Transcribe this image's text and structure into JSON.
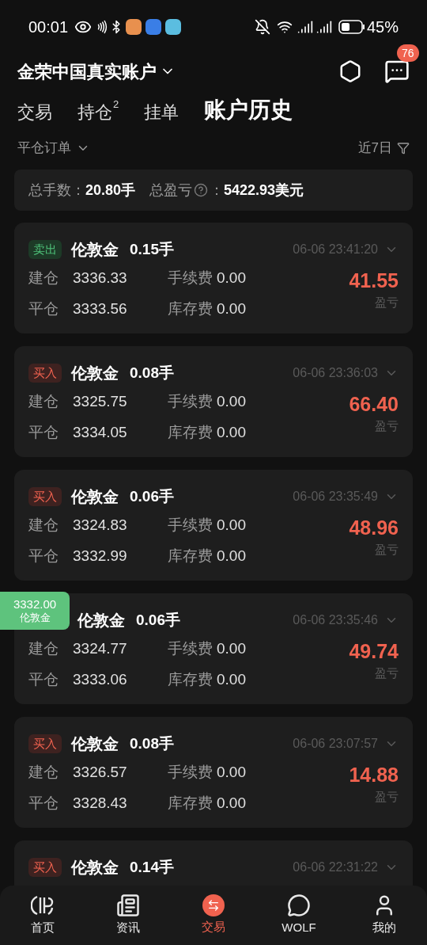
{
  "status_bar": {
    "time": "00:01",
    "battery": "45%"
  },
  "header": {
    "account": "金荣中国真实账户",
    "message_badge": "76"
  },
  "tabs": [
    {
      "label": "交易",
      "selected": false
    },
    {
      "label": "持仓",
      "badge": "2",
      "selected": false
    },
    {
      "label": "挂单",
      "selected": false
    },
    {
      "label": "账户历史",
      "selected": true
    }
  ],
  "filter": {
    "order_type": "平仓订单",
    "range": "近7日"
  },
  "summary": {
    "lots_label": "总手数：",
    "lots": "20.80手",
    "pnl_label": "总盈亏",
    "colon": "：",
    "pnl": "5422.93美元"
  },
  "orders": [
    {
      "side": "卖出",
      "kind": "sell",
      "symbol": "伦敦金",
      "lots": "0.15手",
      "time": "06-06 23:41:20",
      "open_label": "建仓",
      "open": "3336.33",
      "close_label": "平仓",
      "close": "3333.56",
      "fee_label": "手续费",
      "fee": "0.00",
      "swap_label": "库存费",
      "swap": "0.00",
      "profit": "41.55",
      "profit_label": "盈亏"
    },
    {
      "side": "买入",
      "kind": "buy",
      "symbol": "伦敦金",
      "lots": "0.08手",
      "time": "06-06 23:36:03",
      "open_label": "建仓",
      "open": "3325.75",
      "close_label": "平仓",
      "close": "3334.05",
      "fee_label": "手续费",
      "fee": "0.00",
      "swap_label": "库存费",
      "swap": "0.00",
      "profit": "66.40",
      "profit_label": "盈亏"
    },
    {
      "side": "买入",
      "kind": "buy",
      "symbol": "伦敦金",
      "lots": "0.06手",
      "time": "06-06 23:35:49",
      "open_label": "建仓",
      "open": "3324.83",
      "close_label": "平仓",
      "close": "3332.99",
      "fee_label": "手续费",
      "fee": "0.00",
      "swap_label": "库存费",
      "swap": "0.00",
      "profit": "48.96",
      "profit_label": "盈亏"
    },
    {
      "kind": "hidden",
      "symbol": "伦敦金",
      "lots": "0.06手",
      "time": "06-06 23:35:46",
      "open_label": "建仓",
      "open": "3324.77",
      "close_label": "平仓",
      "close": "3333.06",
      "fee_label": "手续费",
      "fee": "0.00",
      "swap_label": "库存费",
      "swap": "0.00",
      "profit": "49.74",
      "profit_label": "盈亏",
      "price_tag": {
        "price": "3332.00",
        "symbol": "伦敦金"
      }
    },
    {
      "side": "买入",
      "kind": "buy",
      "symbol": "伦敦金",
      "lots": "0.08手",
      "time": "06-06 23:07:57",
      "open_label": "建仓",
      "open": "3326.57",
      "close_label": "平仓",
      "close": "3328.43",
      "fee_label": "手续费",
      "fee": "0.00",
      "swap_label": "库存费",
      "swap": "0.00",
      "profit": "14.88",
      "profit_label": "盈亏"
    },
    {
      "side": "买入",
      "kind": "buy",
      "symbol": "伦敦金",
      "lots": "0.14手",
      "time": "06-06 22:31:22"
    }
  ],
  "nav": [
    {
      "label": "首页",
      "kind": "home",
      "selected": false
    },
    {
      "label": "资讯",
      "kind": "news",
      "selected": false
    },
    {
      "label": "交易",
      "kind": "trade",
      "selected": true
    },
    {
      "label": "WOLF",
      "kind": "wolf",
      "selected": false
    },
    {
      "label": "我的",
      "kind": "user",
      "selected": false
    }
  ]
}
